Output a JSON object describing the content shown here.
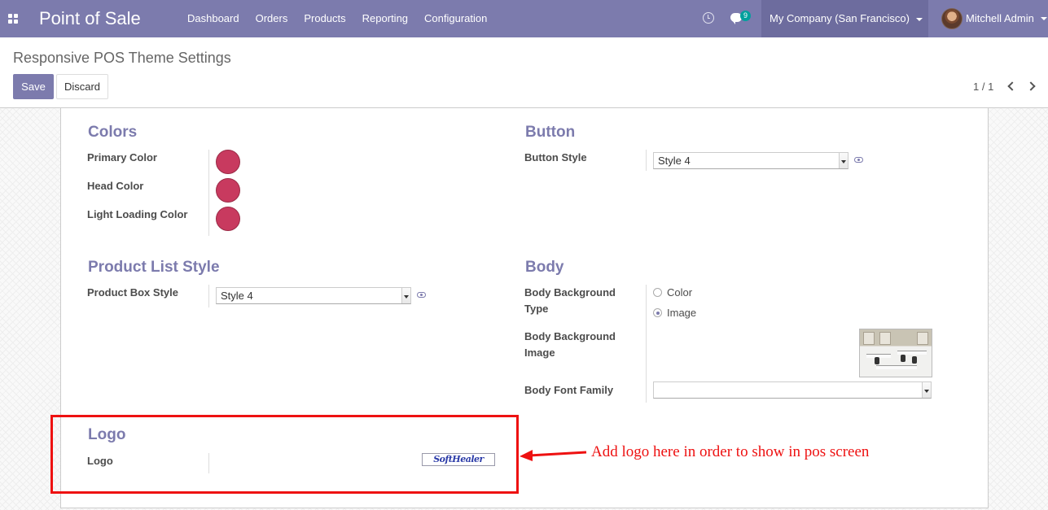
{
  "app": {
    "title": "Point of Sale"
  },
  "navbar": {
    "menu": [
      "Dashboard",
      "Orders",
      "Products",
      "Reporting",
      "Configuration"
    ],
    "chat_count": "9",
    "company": "My Company (San Francisco)",
    "user": "Mitchell Admin",
    "color": "#7c7bad"
  },
  "control": {
    "breadcrumb": "Responsive POS Theme Settings",
    "save_label": "Save",
    "discard_label": "Discard",
    "pager": "1 / 1"
  },
  "form": {
    "colors": {
      "title": "Colors",
      "fields": [
        {
          "label": "Primary Color",
          "value": "#c83a5f"
        },
        {
          "label": "Head Color",
          "value": "#c83a5f"
        },
        {
          "label": "Light Loading Color",
          "value": "#c83a5f"
        }
      ]
    },
    "button": {
      "title": "Button",
      "style_label": "Button Style",
      "style_value": "Style 4"
    },
    "product_list": {
      "title": "Product List Style",
      "box_label": "Product Box Style",
      "box_value": "Style 4"
    },
    "body": {
      "title": "Body",
      "bg_type_label": "Body Background Type",
      "bg_type_options": [
        "Color",
        "Image"
      ],
      "bg_type_selected": "Image",
      "bg_image_label": "Body Background Image",
      "font_family_label": "Body Font Family",
      "font_family_value": ""
    },
    "logo": {
      "title": "Logo",
      "label": "Logo",
      "image_text": "SoftHealer"
    }
  },
  "annotation": {
    "text": "Add logo here in order to show in pos screen",
    "color": "#ee1111"
  }
}
